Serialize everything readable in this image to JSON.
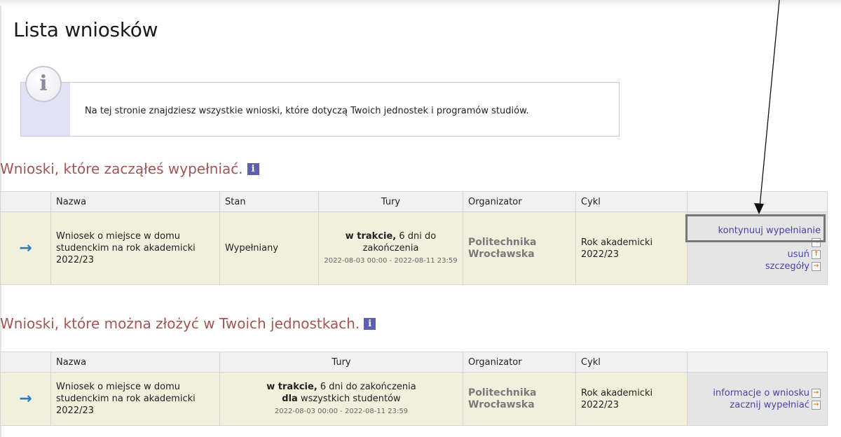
{
  "page": {
    "title": "Lista wniosków"
  },
  "info": {
    "icon": "info-icon",
    "text": "Na tej stronie znajdziesz wszystkie wnioski, które dotyczą Twoich jednostek i programów studiów."
  },
  "section1": {
    "title": "Wnioski, które zacząłeś wypełniać.",
    "headers": {
      "nazwa": "Nazwa",
      "stan": "Stan",
      "tury": "Tury",
      "organizator": "Organizator",
      "cykl": "Cykl"
    },
    "row": {
      "nazwa": "Wniosek o miejsce w domu studenckim na rok akademicki 2022/23",
      "stan": "Wypełniany",
      "tury_status": "w trakcie,",
      "tury_remaining": " 6 dni do zakończenia",
      "tury_dates": "2022-08-03 00:00 - 2022-08-11 23:59",
      "organizator": "Politechnika Wrocławska",
      "cykl": "Rok akademicki 2022/23",
      "actions": [
        "kontynuuj wypełnianie",
        "usuń",
        "szczegóły"
      ]
    }
  },
  "section2": {
    "title": "Wnioski, które można złożyć w Twoich jednostkach.",
    "headers": {
      "nazwa": "Nazwa",
      "tury": "Tury",
      "organizator": "Organizator",
      "cykl": "Cykl"
    },
    "row": {
      "nazwa": "Wniosek o miejsce w domu studenckim na rok akademicki 2022/23",
      "tury_status": "w trakcie,",
      "tury_remaining": " 6 dni do zakończenia",
      "tury_for_bold": "dla",
      "tury_for_rest": " wszystkich studentów",
      "tury_dates": "2022-08-03 00:00 - 2022-08-11 23:59",
      "organizator": "Politechnika Wrocławska",
      "cykl": "Rok akademicki 2022/23",
      "actions": [
        "informacje o wniosku",
        "zacznij wypełniać"
      ]
    }
  },
  "colors": {
    "section_title": "#a35555",
    "link": "#4a43a8",
    "row_bg": "#f0f0dc",
    "arrow": "#2f7cb8",
    "info_strip": "#e3e2f4",
    "annotation": "#777777"
  }
}
